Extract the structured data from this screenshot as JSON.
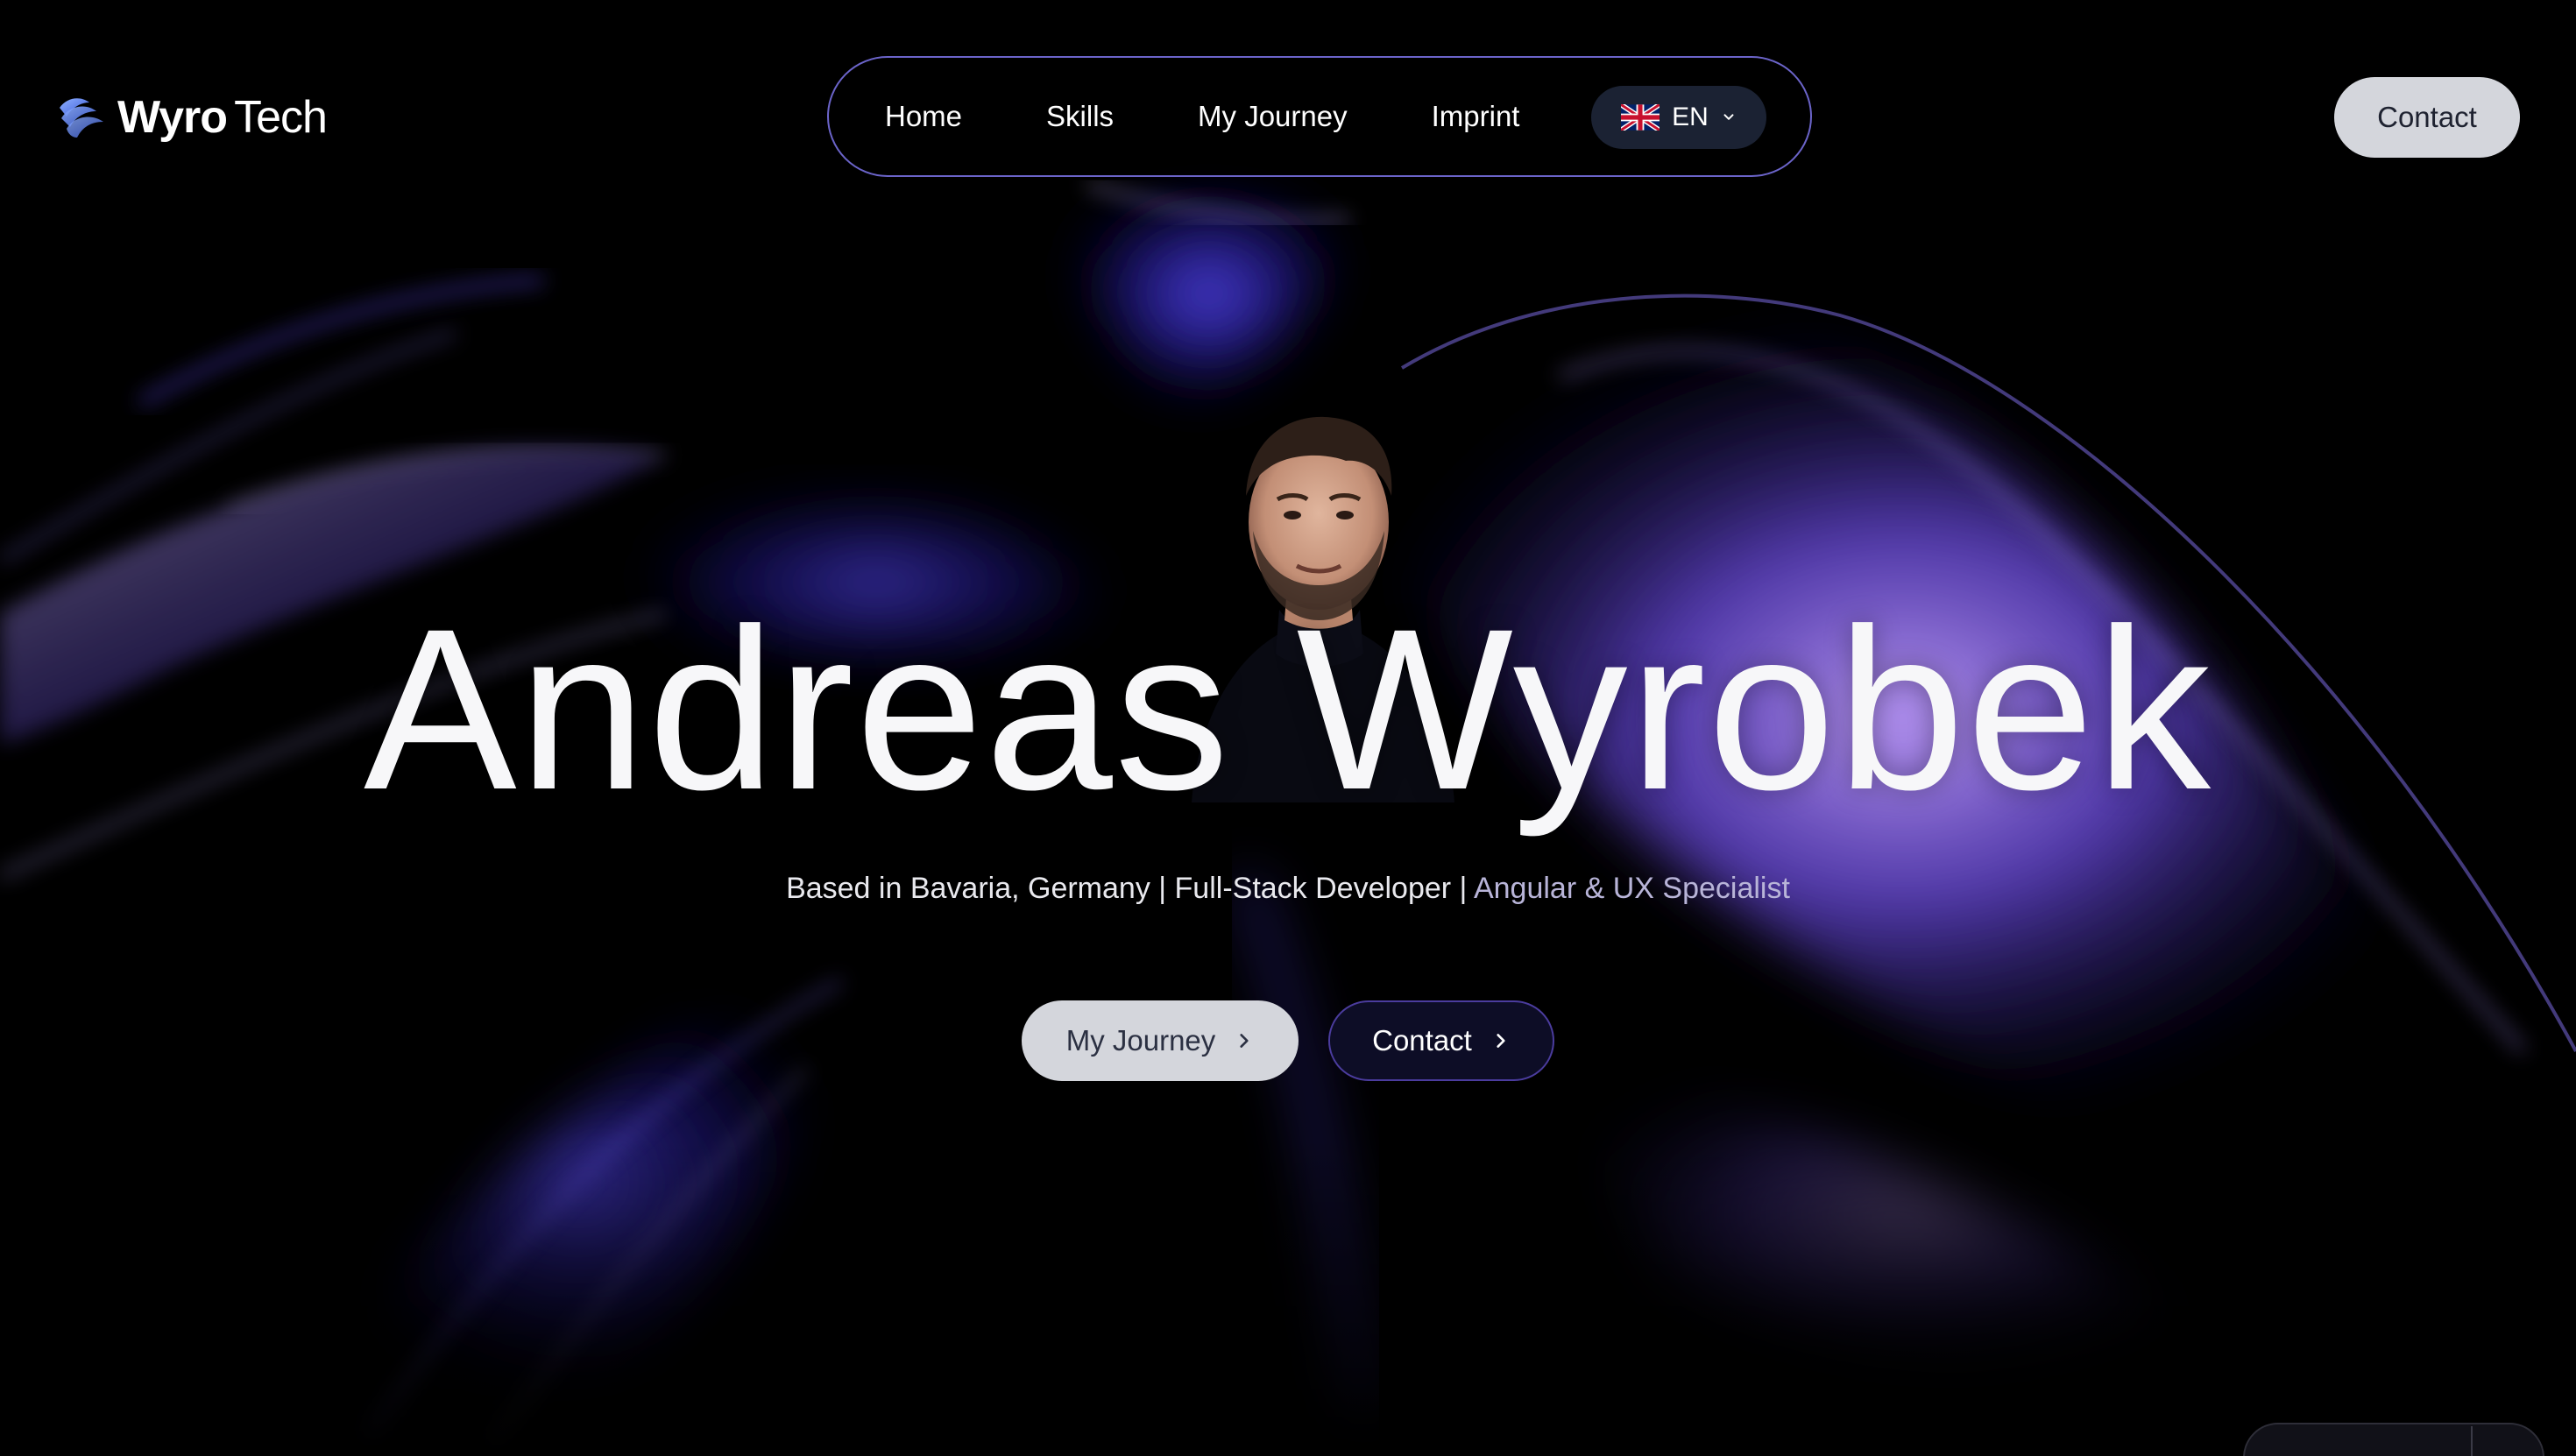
{
  "brand": {
    "name_strong": "Wyro",
    "name_light": "Tech",
    "logo_icon": "layered-wave-logo-icon"
  },
  "nav": {
    "items": [
      "Home",
      "Skills",
      "My Journey",
      "Imprint"
    ],
    "language": {
      "code": "EN",
      "flag_icon": "uk-flag-icon",
      "dropdown_icon": "chevron-down-icon"
    }
  },
  "header_contact_label": "Contact",
  "hero": {
    "name": "Andreas Wyrobek",
    "subtitle_main": "Based in Bavaria, Germany | Full-Stack Developer |",
    "subtitle_accent": "Angular & UX Specialist",
    "buttons": {
      "journey_label": "My Journey",
      "contact_label": "Contact",
      "arrow_icon": "chevron-right-icon"
    }
  },
  "colors": {
    "background": "#000000",
    "nav_border": "#6b64c9",
    "accent_purple": "#7a4fe0",
    "light_button": "#d4d6dc",
    "dark_button": "#0d0d26",
    "subtitle_accent": "#b8b4d8"
  }
}
